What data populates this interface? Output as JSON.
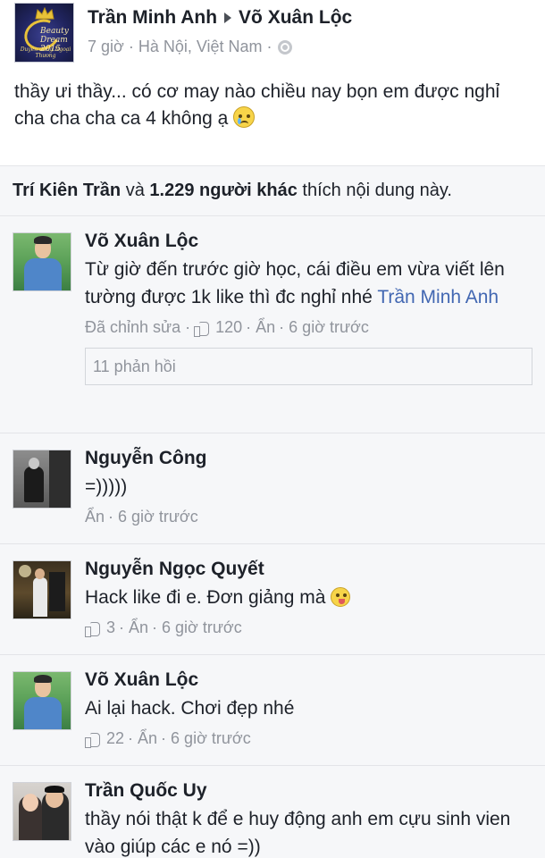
{
  "post": {
    "author": "Trần Minh Anh",
    "target": "Võ Xuân Lộc",
    "time": "7 giờ · Hà Nội, Việt Nam ·",
    "text": "thầy ưi thầy... có cơ may nào chiều nay bọn em được nghỉ cha cha cha ca 4 không ạ",
    "avatar_logo_text": "Beauty Dream 2015",
    "avatar_logo_sub": "Duyên dáng Ngoại Thương"
  },
  "likes": {
    "first_name": "Trí Kiên Trần",
    "conj": "và",
    "others": "1.229 người khác",
    "suffix": "thích nội dung này."
  },
  "comments": [
    {
      "name": "Võ Xuân Lộc",
      "text": "Từ giờ đến trước giờ học, cái điều em vừa viết lên tường được 1k like thì đc nghỉ nhé",
      "mention": "Trần Minh Anh",
      "edited": "Đã chỉnh sửa ·",
      "likes": "120",
      "hide": "· Ẩn",
      "time": "· 6 giờ trước",
      "replies": "11 phản hồi"
    },
    {
      "name": "Nguyễn Công",
      "text": "=)))))",
      "hide": "Ẩn",
      "time": "· 6 giờ trước"
    },
    {
      "name": "Nguyễn Ngọc Quyết",
      "text": "Hack like đi e. Đơn giảng mà",
      "likes": "3",
      "hide": "· Ẩn",
      "time": "· 6 giờ trước"
    },
    {
      "name": "Võ Xuân Lộc",
      "text": "Ai lại hack. Chơi đẹp nhé",
      "likes": "22",
      "hide": "· Ẩn",
      "time": "· 6 giờ trước"
    },
    {
      "name": "Trần Quốc Uy",
      "text": "thầy nói thật k để e huy động anh em cựu sinh vien vào giúp các e nó =))"
    }
  ]
}
